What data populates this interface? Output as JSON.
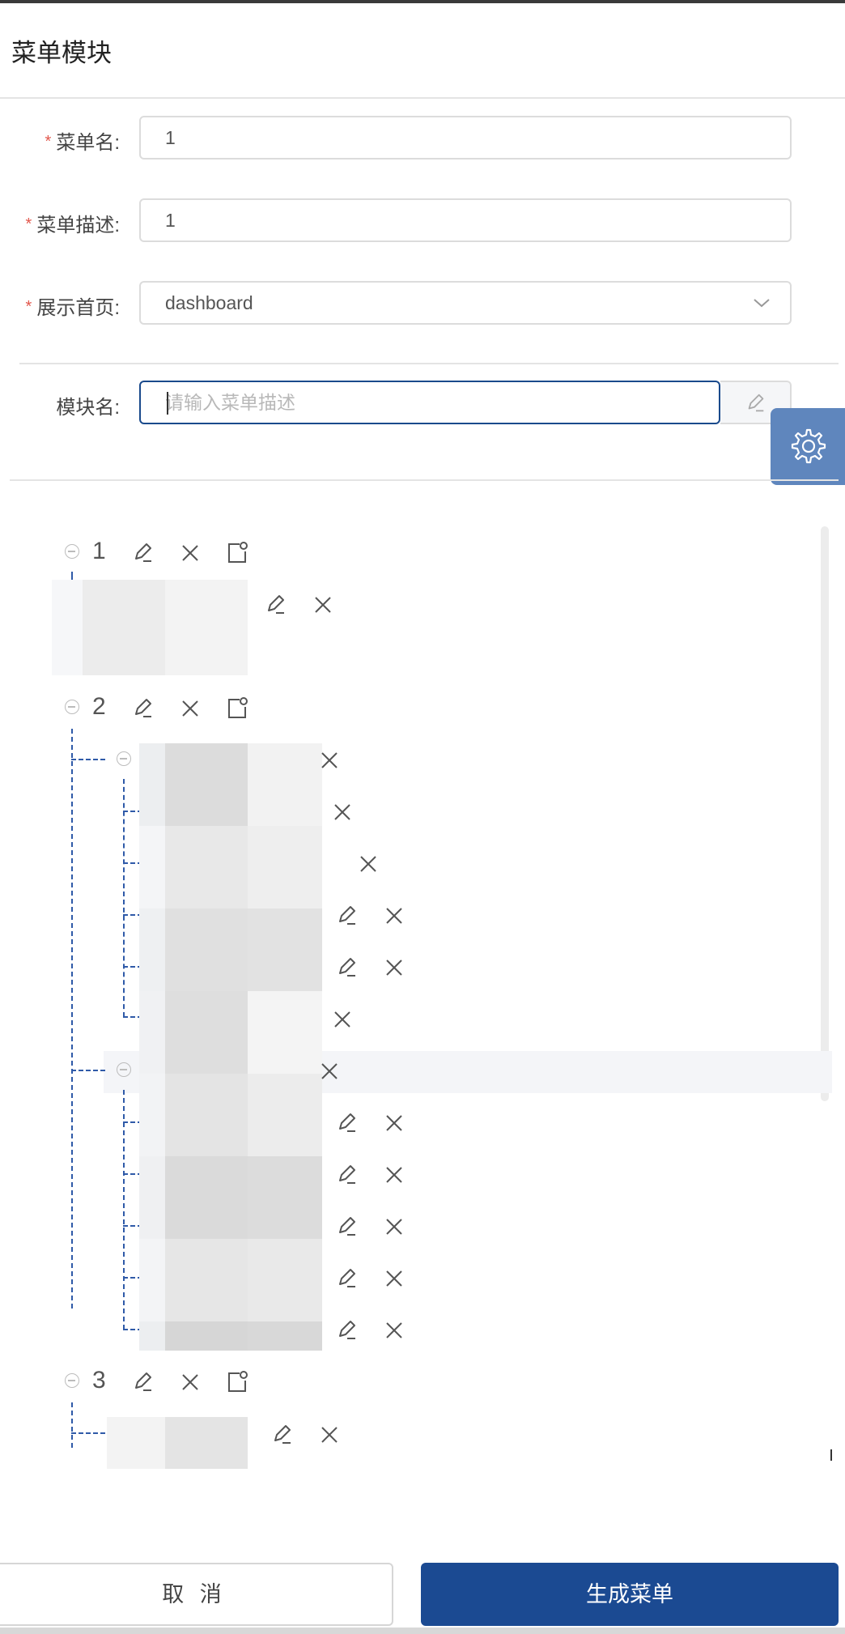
{
  "dialog": {
    "title": "菜单模块"
  },
  "form": {
    "required_mark": "*",
    "menu_name": {
      "label": "菜单名:",
      "value": "1"
    },
    "menu_desc": {
      "label": "菜单描述:",
      "value": "1"
    },
    "home_page": {
      "label": "展示首页:",
      "value": "dashboard"
    },
    "module_name": {
      "label": "模块名:",
      "placeholder": "请输入菜单描述"
    }
  },
  "tree": {
    "nodes": [
      {
        "label": "1"
      },
      {
        "label": "2"
      },
      {
        "label": "3"
      }
    ]
  },
  "icons": {
    "edit": "edit-icon",
    "delete": "close-icon",
    "add_child": "add-child-icon",
    "collapse": "collapse-icon",
    "settings": "gear-icon",
    "select": "chevron-down-icon"
  },
  "footer": {
    "cancel_label": "取 消",
    "generate_label": "生成菜单"
  },
  "colors": {
    "primary": "#1b4a92",
    "required": "#e2574c",
    "gear_bg": "#5f86bd",
    "tree_line": "#2f5aa8"
  }
}
